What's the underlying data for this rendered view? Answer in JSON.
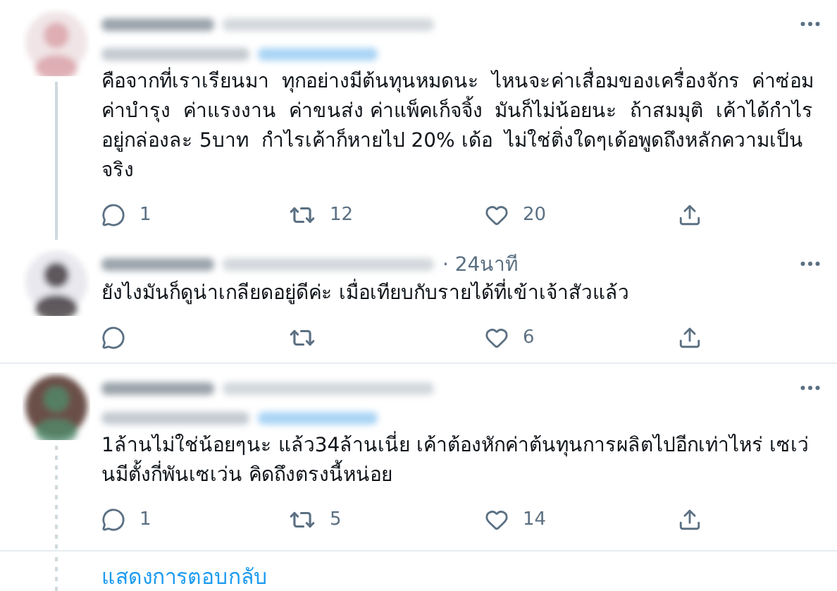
{
  "tweets": [
    {
      "replying_to": true,
      "thread_line": true,
      "text": "คือจากที่เราเรียนมา  ทุกอย่างมีต้นทุนหมดนะ  ไหนจะค่าเสื่อมของเครื่องจักร  ค่าซ่อม ค่าบำรุง  ค่าแรงงาน  ค่าขนส่ง ค่าแพ็คเก็จจิ้ง  มันก็ไม่น้อยนะ  ถ้าสมมุติ  เค้าได้กำไร อยู่กล่องละ 5บาท  กำไรเค้าก็หายไป 20% เด้อ  ไม่ใช่ติ่งใดๆเด้อพูดถึงหลักความเป็น จริง",
      "replies": "1",
      "retweets": "12",
      "likes": "20"
    },
    {
      "time": "· 24นาที",
      "replying_to": false,
      "thread_line": false,
      "text": "ยังไงมันก็ดูน่าเกลียดอยู่ดีค่ะ เมื่อเทียบกับรายได้ที่เข้าเจ้าสัวแล้ว",
      "likes": "6"
    },
    {
      "replying_to": true,
      "thread_line": true,
      "text": "1ล้านไม่ใช่น้อยๆนะ แล้ว34ล้านเนี่ย เค้าต้องหักค่าต้นทุนการผลิตไปอีกเท่าไหร่ เซเว่ นมีตั้งกี่พันเซเว่น คิดถึงตรงนี้หน่อย",
      "replies": "1",
      "retweets": "5",
      "likes": "14",
      "show_replies": "แสดงการตอบกลับ"
    }
  ]
}
